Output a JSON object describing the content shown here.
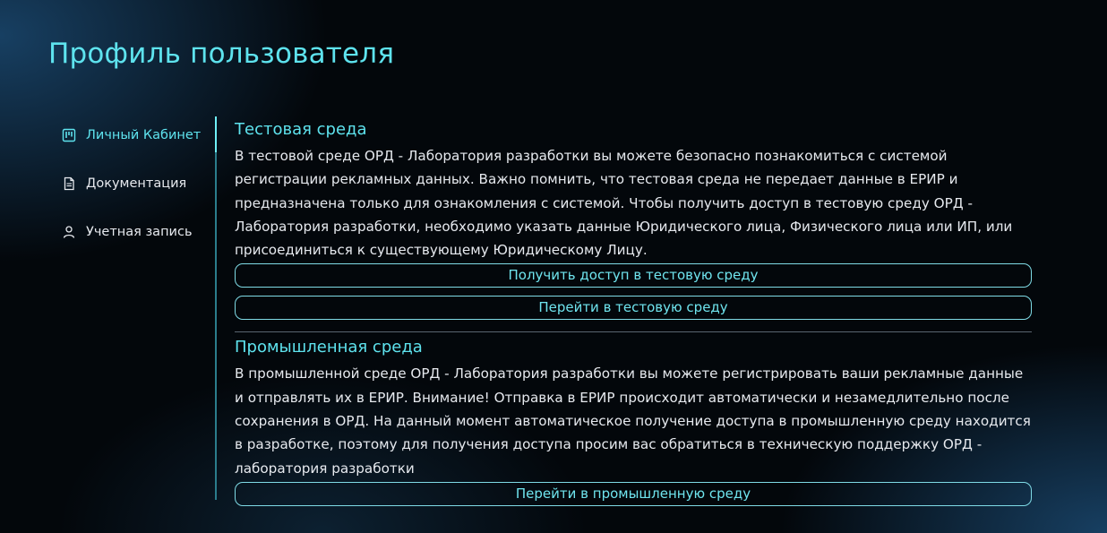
{
  "page": {
    "title": "Профиль пользователя"
  },
  "sidebar": {
    "items": [
      {
        "label": "Личный Кабинет",
        "icon": "kanban-icon",
        "active": true
      },
      {
        "label": "Документация",
        "icon": "document-icon",
        "active": false
      },
      {
        "label": "Учетная запись",
        "icon": "user-icon",
        "active": false
      }
    ]
  },
  "test_env": {
    "title": "Тестовая среда",
    "description": "В тестовой среде ОРД - Лаборатория разработки вы можете безопасно познакомиться с системой регистрации рекламных данных. Важно помнить, что тестовая среда не передает данные в ЕРИР и предназначена только для ознакомления с системой. Чтобы получить доступ в тестовую среду ОРД - Лаборатория разработки, необходимо указать данные Юридического лица, Физического лица или ИП, или присоединиться к существующему Юридическому Лицу.",
    "get_access_label": "Получить доступ в тестовую среду",
    "go_label": "Перейти в тестовую среду"
  },
  "prod_env": {
    "title": "Промышленная среда",
    "description": "В промышленной среде ОРД - Лаборатория разработки вы можете регистрировать ваши рекламные данные и отправлять их в ЕРИР. Внимание! Отправка в ЕРИР происходит автоматически и незамедлительно после сохранения в ОРД. На данный момент автоматическое получение доступа в промышленную среду находится в разработке, поэтому для получения доступа просим вас обратиться в техническую поддержку ОРД - лаборатория разработки",
    "go_label": "Перейти в промышленную среду"
  },
  "colors": {
    "accent": "#5ee3ee",
    "border": "#7fdbe6",
    "background": "#03070b"
  }
}
